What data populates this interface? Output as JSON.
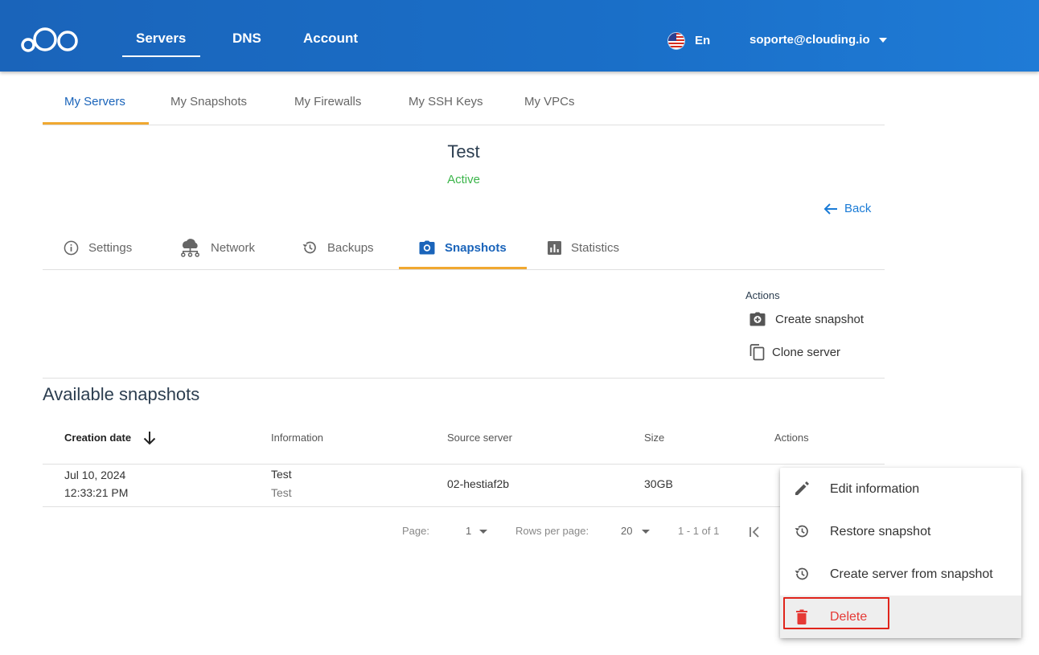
{
  "header": {
    "nav": [
      "Servers",
      "DNS",
      "Account"
    ],
    "language": "En",
    "user_email": "soporte@clouding.io"
  },
  "top_tabs": [
    "My Servers",
    "My Snapshots",
    "My Firewalls",
    "My SSH Keys",
    "My VPCs"
  ],
  "server": {
    "name": "Test",
    "status": "Active"
  },
  "back_label": "Back",
  "server_tabs": [
    "Settings",
    "Network",
    "Backups",
    "Snapshots",
    "Statistics"
  ],
  "actions": {
    "title": "Actions",
    "create_snapshot": "Create snapshot",
    "clone_server": "Clone server"
  },
  "snapshots": {
    "title": "Available snapshots",
    "columns": [
      "Creation date",
      "Information",
      "Source server",
      "Size",
      "Actions"
    ],
    "rows": [
      {
        "date": "Jul 10, 2024",
        "time": "12:33:21 PM",
        "info_line1": "Test",
        "info_line2": "Test",
        "source": "02-hestiaf2b",
        "size": "30GB"
      }
    ]
  },
  "pagination": {
    "page_label": "Page:",
    "page_value": "1",
    "rows_label": "Rows per page:",
    "rows_value": "20",
    "range": "1 - 1 of 1"
  },
  "context_menu": {
    "items": [
      "Edit information",
      "Restore snapshot",
      "Create server from snapshot",
      "Delete"
    ]
  },
  "colors": {
    "header_bg": "#1a64ba",
    "accent": "#f0a830",
    "active_tab": "#1a64ba",
    "status_active": "#3bb54a",
    "danger": "#e53935"
  }
}
